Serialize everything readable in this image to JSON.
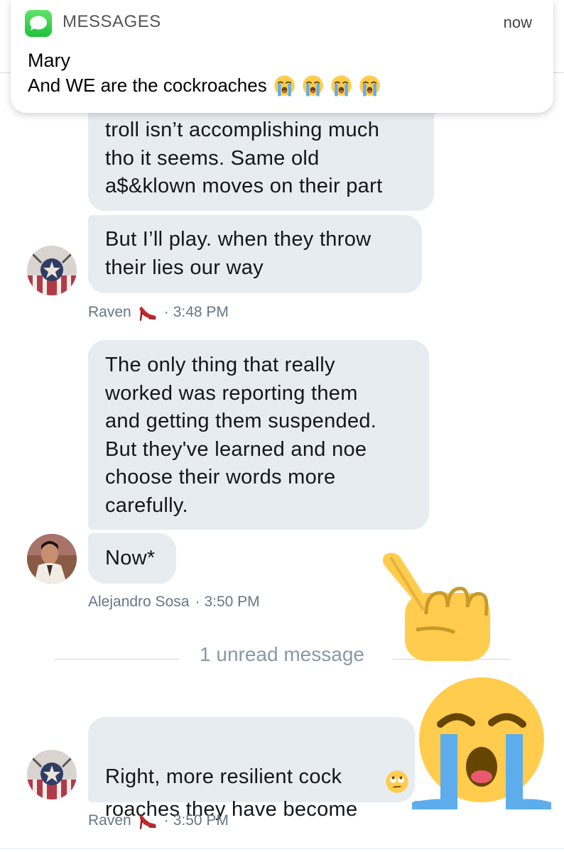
{
  "notification": {
    "app_name": "MESSAGES",
    "time": "now",
    "sender": "Mary",
    "preview": "And WE are the cockroaches"
  },
  "conversation": {
    "messages": [
      {
        "text": "troll isn’t accomplishing much\ntho it seems. Same old\na$&klown moves on their part"
      },
      {
        "text": "But I’ll play. when they throw\ntheir lies our way"
      },
      {
        "text": "The only thing that really\nworked was reporting them\nand getting them suspended.\nBut they've learned and noe\nchoose their words more\ncarefully."
      },
      {
        "text": "Now*"
      },
      {
        "text": "Right, more resilient cock\nroaches they have become"
      }
    ],
    "meta": [
      {
        "name": "Raven",
        "time": "3:48 PM"
      },
      {
        "name": "Alejandro Sosa",
        "time": "3:50 PM"
      },
      {
        "name": "Raven",
        "time": "3:50 PM"
      }
    ],
    "unread_divider": "1 unread message"
  },
  "icons": [
    "messages-app-icon",
    "loudly-crying-face-icon",
    "high-heel-icon",
    "face-with-rolling-eyes-icon",
    "hand-pointing-up-icon"
  ],
  "colors": {
    "bubble": "#e6ecf0",
    "meta_text": "#657786",
    "divider_text": "#8899a6",
    "app_icon_green": "#1ec13a"
  }
}
